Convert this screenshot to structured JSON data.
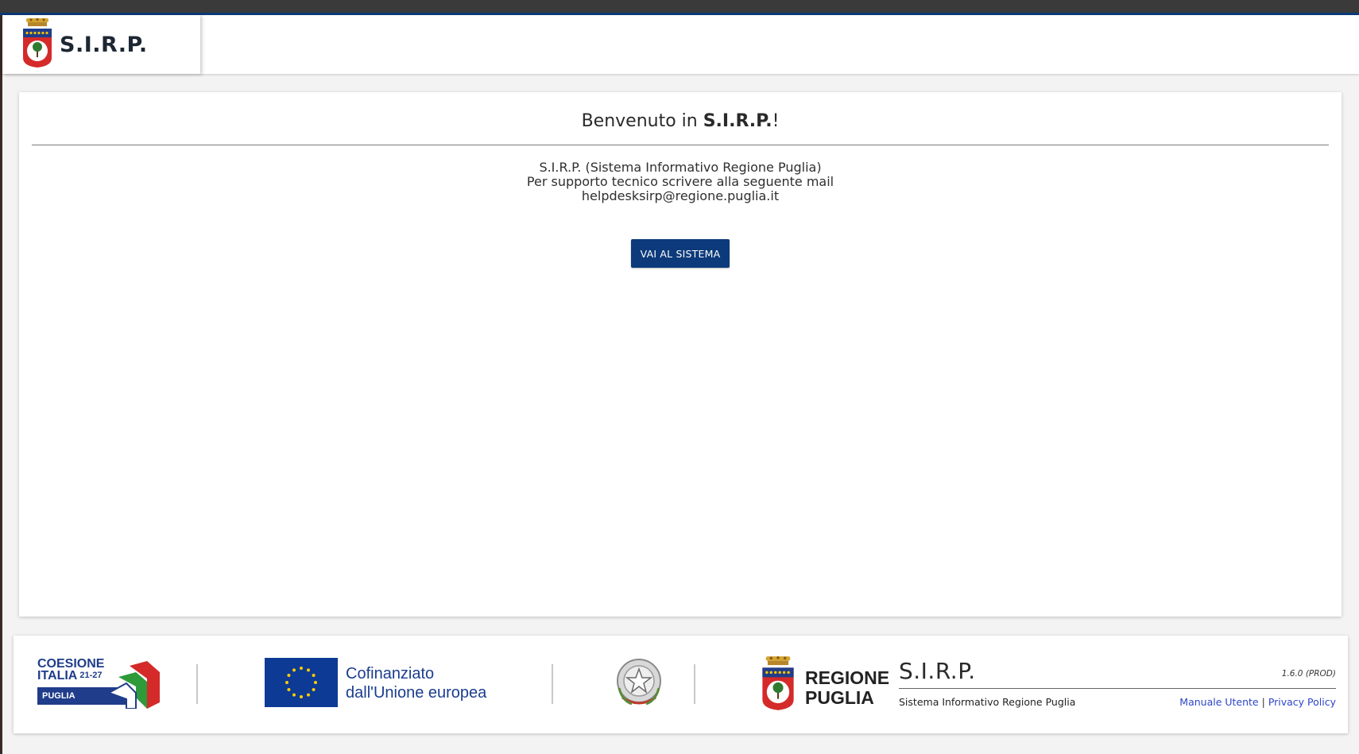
{
  "header": {
    "brand_title": "S.I.R.P."
  },
  "welcome": {
    "prefix": "Benvenuto in ",
    "app_name": "S.I.R.P.",
    "suffix": "!"
  },
  "info": {
    "line1": "S.I.R.P. (Sistema Informativo Regione Puglia)",
    "line2": "Per supporto tecnico scrivere alla seguente mail",
    "email": "helpdesksirp@regione.puglia.it"
  },
  "actions": {
    "go_label": "VAI AL SISTEMA"
  },
  "footer": {
    "coesione": {
      "line1": "COESIONE",
      "line2": "ITALIA",
      "year": "21-27",
      "region": "PUGLIA"
    },
    "eu": {
      "line1": "Cofinanziato",
      "line2": "dall'Unione europea"
    },
    "regione": {
      "line1": "REGIONE",
      "line2": "PUGLIA"
    },
    "sirp": {
      "name": "S.I.R.P.",
      "version": "1.6.0 (PROD)",
      "description": "Sistema Informativo Regione Puglia",
      "manual_link": "Manuale Utente",
      "link_separator": "|",
      "privacy_link": "Privacy Policy"
    }
  },
  "colors": {
    "primary": "#0c3a7a",
    "link": "#2d45c8",
    "eu_blue": "#0d3a94",
    "eu_star": "#ffcc00",
    "crest_red": "#d42a2a"
  }
}
